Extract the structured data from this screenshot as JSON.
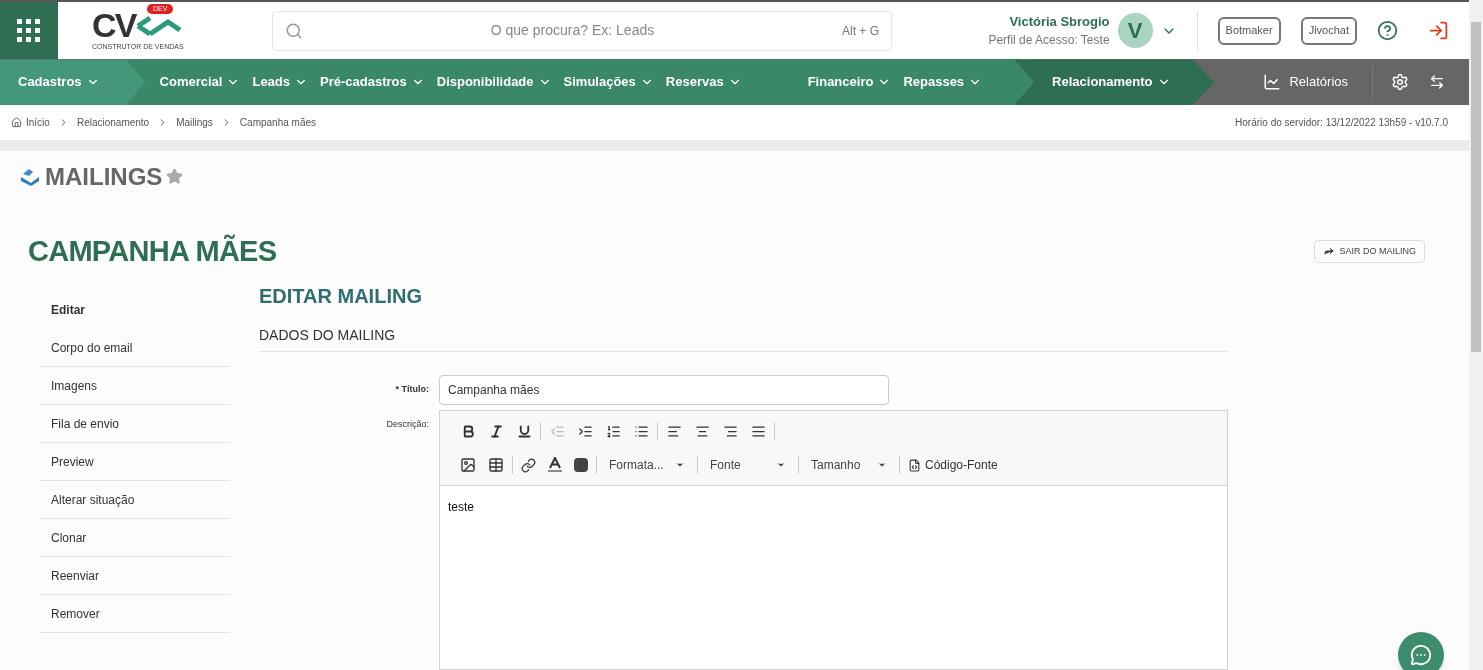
{
  "header": {
    "logo": {
      "letters": "CV",
      "badge": "DEV",
      "tagline": "CONSTRUTOR DE VENDAS"
    },
    "search": {
      "placeholder": "O que procura? Ex: Leads",
      "shortcut": "Alt + G"
    },
    "user": {
      "name": "Victória Sbrogio",
      "profile": "Perfil de Acesso: Teste",
      "initial": "V"
    },
    "buttons": [
      "Botmaker",
      "Jivochat"
    ]
  },
  "nav": {
    "items": [
      {
        "label": "Cadastros",
        "highlighted": true,
        "selected": false
      },
      {
        "label": "Comercial",
        "highlighted": false,
        "selected": false
      },
      {
        "label": "Leads",
        "highlighted": false,
        "selected": false
      },
      {
        "label": "Pré-cadastros",
        "highlighted": false,
        "selected": false
      },
      {
        "label": "Disponibilidade",
        "highlighted": false,
        "selected": false
      },
      {
        "label": "Simulações",
        "highlighted": false,
        "selected": false
      },
      {
        "label": "Reservas",
        "highlighted": false,
        "selected": false
      },
      {
        "label": "Financeiro",
        "highlighted": false,
        "selected": false
      },
      {
        "label": "Repasses",
        "highlighted": false,
        "selected": false
      },
      {
        "label": "Relacionamento",
        "highlighted": false,
        "selected": true
      }
    ],
    "reports": "Relatórios"
  },
  "breadcrumb": [
    "Início",
    "Relacionamento",
    "Mailings",
    "Campanha mães"
  ],
  "server_time": "Horário do servidor: 13/12/2022 13h59 - v10.7.0",
  "module_title": "MAILINGS",
  "page_title": "CAMPANHA MÃES",
  "exit_button": "SAIR DO MAILING",
  "side_menu": [
    {
      "label": "Editar",
      "selected": true
    },
    {
      "label": "Corpo do email",
      "selected": false
    },
    {
      "label": "Imagens",
      "selected": false
    },
    {
      "label": "Fila de envio",
      "selected": false
    },
    {
      "label": "Preview",
      "selected": false
    },
    {
      "label": "Alterar situação",
      "selected": false
    },
    {
      "label": "Clonar",
      "selected": false
    },
    {
      "label": "Reenviar",
      "selected": false
    },
    {
      "label": "Remover",
      "selected": false
    }
  ],
  "form": {
    "heading": "EDITAR MAILING",
    "section": "DADOS DO MAILING",
    "title_field": {
      "required_mark": "*",
      "label": "Título:",
      "value": "Campanha mães"
    },
    "description_label": "Descrição:",
    "editor": {
      "format_buttons": [
        {
          "disabled": false
        },
        {
          "disabled": false
        },
        {
          "disabled": false
        },
        {
          "disabled": true
        },
        {
          "disabled": false
        },
        {
          "disabled": false
        },
        {
          "disabled": false
        },
        {
          "disabled": false
        },
        {
          "disabled": false
        },
        {
          "disabled": false
        },
        {
          "disabled": false
        }
      ],
      "dropdowns": [
        "Formata...",
        "Fonte",
        "Tamanho"
      ],
      "source_button": "Código-Fonte",
      "content": "teste"
    }
  }
}
